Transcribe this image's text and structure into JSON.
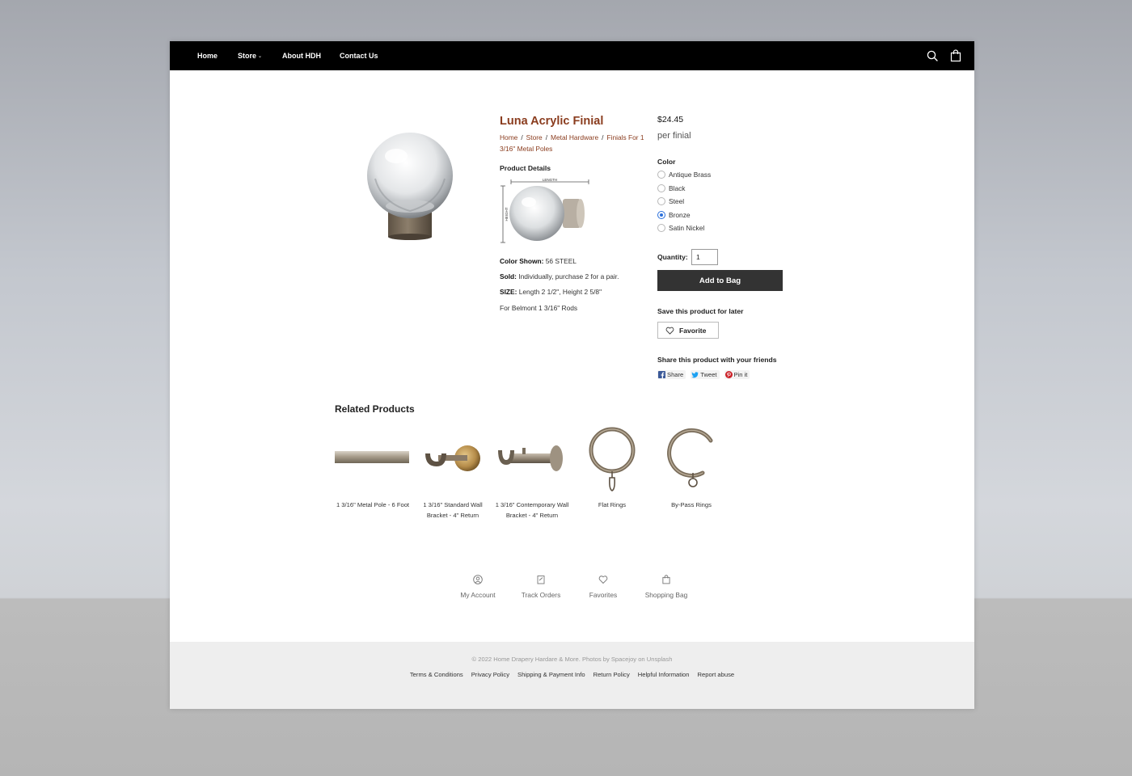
{
  "nav": {
    "items": [
      {
        "label": "Home"
      },
      {
        "label": "Store",
        "chevron": "⌄"
      },
      {
        "label": "About HDH"
      },
      {
        "label": "Contact Us"
      }
    ],
    "icons": [
      "search-icon",
      "shopping-bag-icon"
    ]
  },
  "product": {
    "title": "Luna Acrylic Finial",
    "breadcrumb": [
      "Home",
      "Store",
      "Metal Hardware",
      "Finials For 1 3/16\" Metal Poles"
    ],
    "breadcrumb_sep": "/",
    "details_heading": "Product Details",
    "diagram_labels": {
      "length": "LENGTH",
      "height": "HEIGHT"
    },
    "color_shown_label": "Color Shown:",
    "color_shown_value": "56 STEEL",
    "sold_label": "Sold:",
    "sold_value": "Individually, purchase 2 for a pair.",
    "size_label": "SIZE:",
    "size_value": "Length 2 1/2\", Height 2 5/8\"",
    "rods_note": "For Belmont 1 3/16\" Rods",
    "price": "$24.45",
    "price_unit": "per finial",
    "color_heading": "Color",
    "colors": [
      "Antique Brass",
      "Black",
      "Steel",
      "Bronze",
      "Satin Nickel"
    ],
    "selected_color": "Bronze",
    "quantity_label": "Quantity:",
    "quantity_value": "1",
    "add_to_bag": "Add to Bag",
    "save_heading": "Save this product for later",
    "favorite_label": "Favorite",
    "share_heading": "Share this product with your friends",
    "share": {
      "facebook": "Share",
      "twitter": "Tweet",
      "pinterest": "Pin it"
    }
  },
  "related": {
    "heading": "Related Products",
    "items": [
      {
        "name": "1 3/16\" Metal Pole - 6 Foot"
      },
      {
        "name": "1 3/16\" Standard Wall Bracket - 4\" Return"
      },
      {
        "name": "1 3/16\" Contemporary Wall Bracket - 4\" Return"
      },
      {
        "name": "Flat Rings"
      },
      {
        "name": "By-Pass Rings"
      }
    ]
  },
  "account_links": [
    "My Account",
    "Track Orders",
    "Favorites",
    "Shopping Bag"
  ],
  "footer": {
    "copyright": "© 2022 Home Drapery Hardare & More. Photos by Spacejoy on Unsplash",
    "links": [
      "Terms & Conditions",
      "Privacy Policy",
      "Shipping & Payment Info",
      "Return Policy",
      "Helpful Information",
      "Report abuse"
    ]
  },
  "colors": {
    "accent": "#8a3c1e",
    "nav_bg": "#000000",
    "button_bg": "#333333",
    "radio_selected": "#2a6fdb"
  }
}
